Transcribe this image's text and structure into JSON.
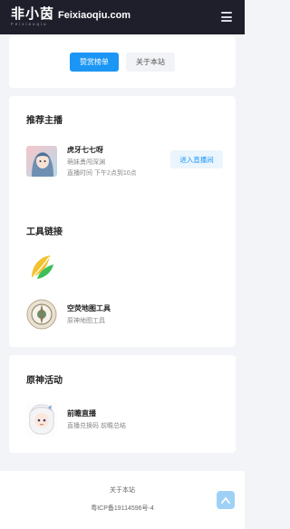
{
  "header": {
    "logo_cn": "非小茵",
    "logo_domain": "Feixiaoqiu.com",
    "logo_sub": "Feixiaoqiu"
  },
  "top_buttons": {
    "primary_label": "赞赏榜单",
    "secondary_label": "关于本站"
  },
  "recommend": {
    "title": "推荐主播",
    "streamer": {
      "name": "虎牙七七呀",
      "desc": "萌妹勇闯深渊",
      "time": "直播时间 下午2点到10点",
      "button_label": "进入直播间"
    }
  },
  "tools": {
    "title": "工具链接",
    "items": [
      {
        "name": "空荧地图工具",
        "desc": "原神地图工具"
      }
    ]
  },
  "events": {
    "title": "原神活动",
    "items": [
      {
        "name": "前瞻直播",
        "desc": "直播兑换码 前瞻总结"
      }
    ]
  },
  "footer": {
    "about": "关于本站",
    "icp": "粤ICP备19114596号-4"
  },
  "colors": {
    "header_bg": "#1e1f2b",
    "accent": "#1c96f5",
    "page_bg": "#f2f4f7"
  }
}
